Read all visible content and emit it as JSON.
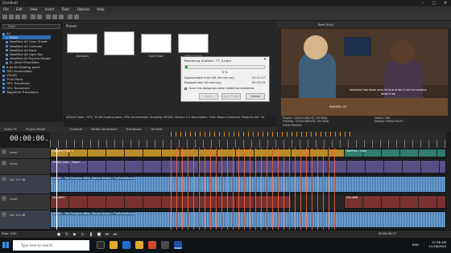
{
  "titlebar": {
    "title": "[Untitled]",
    "minimize": "–",
    "maximize": "□",
    "close": "✕"
  },
  "menu": [
    "File",
    "Edit",
    "View",
    "Insert",
    "Tools",
    "Options",
    "Help"
  ],
  "fx_tree": {
    "search_placeholder": "Flash",
    "items": [
      {
        "label": "All",
        "selected": false
      },
      {
        "label": "Flash",
        "selected": true
      },
      {
        "label": "NewBlue All Color Shade",
        "selected": false
      },
      {
        "label": "NewBlue All Contrast",
        "selected": false
      },
      {
        "label": "NewBlue All Mask",
        "selected": false
      },
      {
        "label": "NewBlue All Light Ray",
        "selected": false
      },
      {
        "label": "NewBlue All Psycho Strobe",
        "selected": false
      },
      {
        "label": "EL_Blue+FlashDots",
        "selected": false
      },
      {
        "label": "8-bit 64 floating point",
        "selected": false
      },
      {
        "label": "GPU Accelerated",
        "selected": false
      },
      {
        "label": "VEGAS",
        "selected": false
      },
      {
        "label": "Third Party",
        "selected": false
      },
      {
        "label": "OFX Transitions",
        "selected": false
      },
      {
        "label": "OFX Transitions",
        "selected": false
      },
      {
        "label": "Toggleme Transitions",
        "selected": false
      }
    ]
  },
  "presets": {
    "label": "Preset:",
    "items": [
      "(Default)",
      "",
      "Soft Flash",
      "Yellow Flash"
    ]
  },
  "description": "VEGAS Flash / OFX, 32-bit floating point, GPU Accelerated, Grouping VEGAS, Version 1.0\nDescription: From Magix Computer Products Intl. Co.",
  "left_tabs": [
    "Video FX",
    "Project Media",
    "Explorer",
    "Media Generators",
    "Transitions",
    "Trimmer"
  ],
  "dialog": {
    "title": "Rendering Untitled - FT_0.mp4",
    "progress_pct": 3,
    "progress_text": "3 %",
    "rows": [
      {
        "label": "Approximate time left (hh:mm:ss):",
        "value": "01:21:27"
      },
      {
        "label": "Elapsed time (hh:mm:ss):",
        "value": "00:03:23"
      }
    ],
    "checkbox": "Close this dialog box when rendering completes",
    "buttons": [
      "Open",
      "Open Folder",
      "Cancel"
    ]
  },
  "preview": {
    "quality": "Best (Full)",
    "caption_line1": "Veronika has been very kind and don't let me explain",
    "caption_line2": "what it be",
    "caption_small": "RAW/SDL 24",
    "info_left": [
      "Project: 1920x1080x32, 59.940p",
      "Preview: 1920x1080x32, 59.940p",
      "Video Preview"
    ],
    "info_right": [
      "Frame: 256",
      "Display: 490x276x32"
    ],
    "tabs": [
      "Video Preview",
      "Trimmer"
    ]
  },
  "timeline": {
    "timecode": "00:00:06.17",
    "tracks": [
      {
        "num": "1",
        "name": "Level",
        "type": "video",
        "clips": [
          {
            "name": "[Legacy] Text 3",
            "color": "#b98b2a"
          },
          {
            "name": "TextFlas - choir",
            "color": "#2e7d6d"
          }
        ]
      },
      {
        "num": "2",
        "name": "Level",
        "type": "video",
        "clips": [
          {
            "name": "VEGAS Intro - Vegas - ...",
            "color": "#5a4e86"
          }
        ]
      },
      {
        "num": "3",
        "name": "Vol: 0.0 dB",
        "type": "audio",
        "clips": [
          {
            "name": "VEGAS - The Dungeon Whip (Demo Version) ThePrettyBeats",
            "color": "#3b6ea5"
          }
        ]
      },
      {
        "num": "4",
        "name": "Level",
        "type": "video",
        "clips": [
          {
            "name": "VID-AMIC",
            "color": "#7a3030"
          },
          {
            "name": "VID-ANB",
            "color": "#7a3030"
          }
        ]
      },
      {
        "num": "5",
        "name": "Vol: 0.0 dB",
        "type": "audio",
        "clips": [
          {
            "name": "VEGAS - The Dungeon Whip (Demo Version) ThePrettyBeats",
            "color": "#3b6ea5"
          }
        ]
      }
    ]
  },
  "transport": {
    "rate": "Rate: 0.00",
    "time": "00:00:06.17"
  },
  "taskbar": {
    "search": "Type here to search",
    "lang": "ENG",
    "time": "12:36 AM",
    "date": "11/16/2020"
  }
}
